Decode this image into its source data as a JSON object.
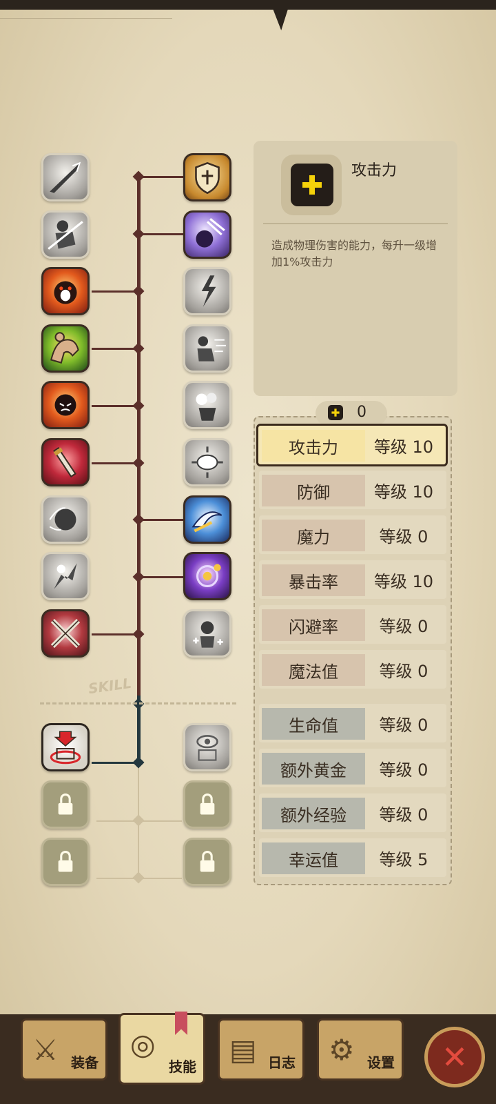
{
  "detail": {
    "title": "攻击力",
    "description": "造成物理伤害的能力，每升一级增加1%攻击力"
  },
  "tree_label": "SKILL",
  "points": {
    "value": "0"
  },
  "stats": [
    {
      "label": "攻击力",
      "value": "等级 10",
      "group": "red",
      "selected": true
    },
    {
      "label": "防御",
      "value": "等级 10",
      "group": "red"
    },
    {
      "label": "魔力",
      "value": "等级 0",
      "group": "red"
    },
    {
      "label": "暴击率",
      "value": "等级 10",
      "group": "red"
    },
    {
      "label": "闪避率",
      "value": "等级 0",
      "group": "red"
    },
    {
      "label": "魔法值",
      "value": "等级 0",
      "group": "red"
    },
    {
      "label": "生命值",
      "value": "等级 0",
      "group": "gray"
    },
    {
      "label": "额外黄金",
      "value": "等级 0",
      "group": "gray"
    },
    {
      "label": "额外经验",
      "value": "等级 0",
      "group": "gray"
    },
    {
      "label": "幸运值",
      "value": "等级 5",
      "group": "gray"
    }
  ],
  "nav": [
    {
      "label": "装备",
      "icon": "equipment-icon"
    },
    {
      "label": "技能",
      "icon": "skill-icon",
      "active": true
    },
    {
      "label": "日志",
      "icon": "log-icon"
    },
    {
      "label": "设置",
      "icon": "settings-gear-icon"
    }
  ],
  "colors": {
    "background": "#e6dbbd",
    "trunk": "#5b2f2a",
    "selected_row": "#f5e7b6",
    "close_button": "#7d2a1e"
  }
}
